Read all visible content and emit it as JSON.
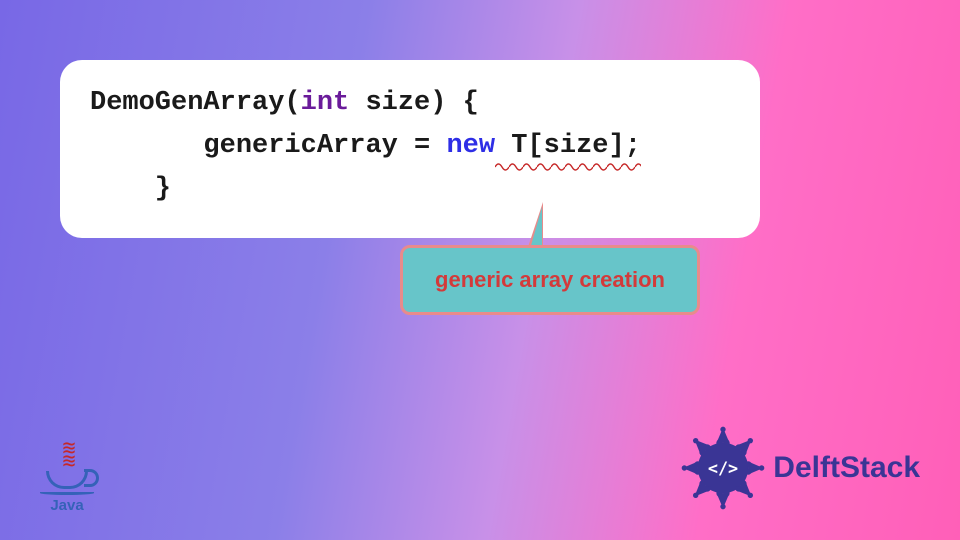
{
  "code": {
    "line1_prefix": "DemoGenArray(",
    "line1_type": "int",
    "line1_suffix": " size) {",
    "line2_indent": "       genericArray = ",
    "line2_new": "new",
    "line2_err": " T[size];",
    "line3": "    }"
  },
  "callout": {
    "text": "generic array creation"
  },
  "logos": {
    "java": "Java",
    "delft": "DelftStack",
    "delft_glyph": "</>"
  },
  "colors": {
    "keyword_type": "#6a1b9a",
    "keyword_new": "#2e2ee6",
    "error_underline": "#c62828",
    "callout_bg": "#67c5c9",
    "callout_border": "#e88b8b",
    "callout_text": "#d33a3a",
    "delft_primary": "#3a3595"
  }
}
